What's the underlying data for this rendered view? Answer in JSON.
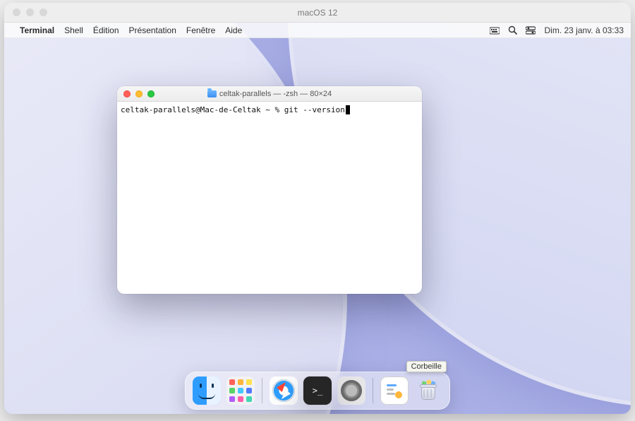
{
  "outer": {
    "title": "macOS 12"
  },
  "menubar": {
    "items": [
      "Terminal",
      "Shell",
      "Édition",
      "Présentation",
      "Fenêtre",
      "Aide"
    ],
    "clock": "Dim. 23 janv. à 03:33"
  },
  "terminal": {
    "title": "celtak-parallels — -zsh — 80×24",
    "prompt": "celtak-parallels@Mac-de-Celtak ~ % ",
    "command": "git --version"
  },
  "dock": {
    "items": [
      {
        "name": "Finder"
      },
      {
        "name": "Launchpad"
      },
      {
        "name": "Safari"
      },
      {
        "name": "Terminal"
      },
      {
        "name": "Réglages Système"
      },
      {
        "name": "Image disque"
      },
      {
        "name": "Corbeille"
      }
    ],
    "tooltip": "Corbeille"
  },
  "launchpad_colors": [
    "#ff6259",
    "#ffb43a",
    "#ffe14d",
    "#58d364",
    "#45c8ff",
    "#4f7bff",
    "#b25cff",
    "#ff5fa9",
    "#41d6b4"
  ]
}
